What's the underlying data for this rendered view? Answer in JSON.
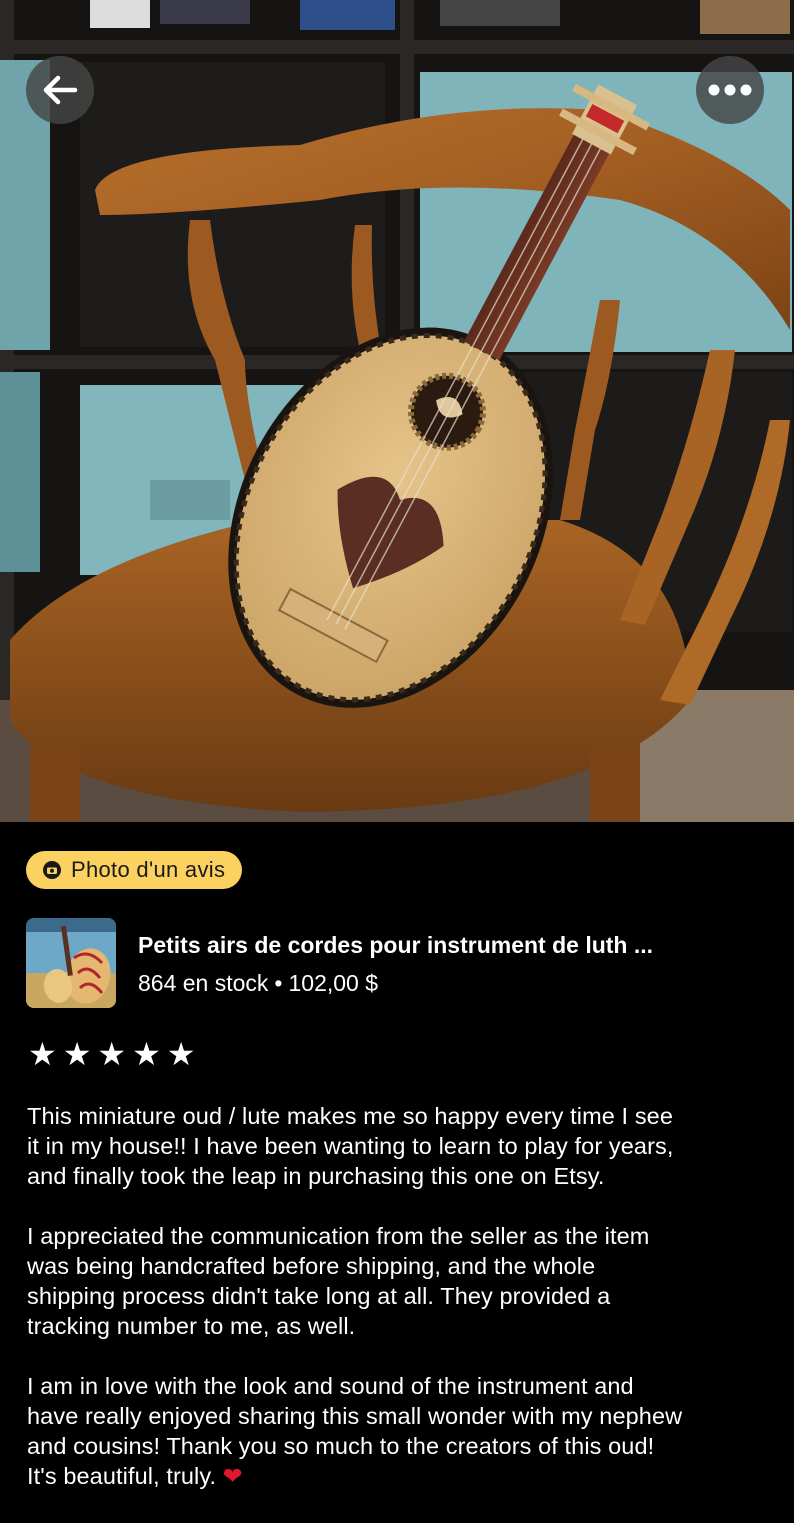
{
  "badge": {
    "icon": "review-camera-icon",
    "label": "Photo d'un avis",
    "color": "#fbd160"
  },
  "product": {
    "title": "Petits airs de cordes pour instrument de luth ...",
    "stock": "864 en stock",
    "separator": "•",
    "price": "102,00 $"
  },
  "rating": {
    "stars": 5,
    "max": 5,
    "glyph": "★"
  },
  "review": {
    "paragraphs": [
      "This miniature oud / lute makes me so happy every time I see\nit in my house!! I have been wanting to learn to play for years,\nand finally took the leap in purchasing this one on Etsy.",
      "I appreciated the communication from the seller as the item\nwas being handcrafted before shipping, and the whole\nshipping process didn't take long at all. They provided a\ntracking number to me, as well.",
      "I am in love with the look and sound of the instrument and\nhave really enjoyed sharing this small wonder with my nephew\nand cousins! Thank you so much to the creators of this oud!\nIt's beautiful, truly."
    ],
    "emoji": "❤"
  },
  "icons": {
    "back": "arrow-left-icon",
    "more": "more-horizontal-icon"
  }
}
